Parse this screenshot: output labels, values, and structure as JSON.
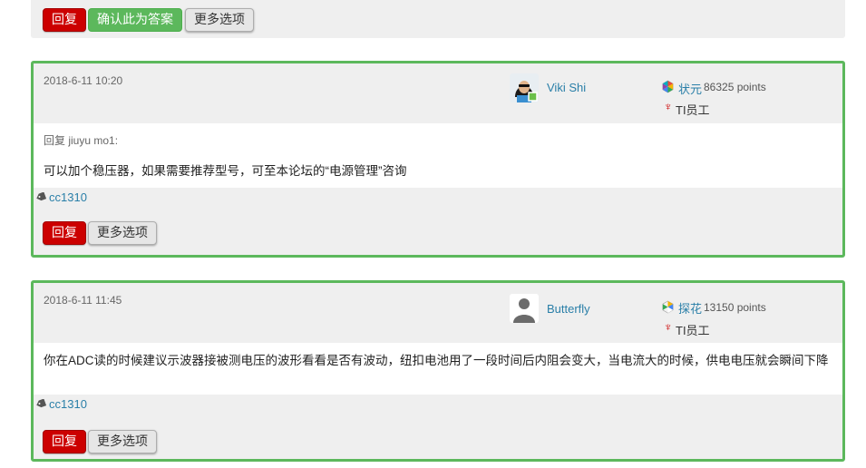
{
  "top_actions": {
    "reply_label": "回复",
    "confirm_label": "确认此为答案",
    "more_label": "更多选项"
  },
  "posts": [
    {
      "date": "2018-6-11 10:20",
      "author": "Viki Shi",
      "rank": "状元",
      "points": "86325 points",
      "badge": "TI员工",
      "reply_to": "回复 jiuyu mo1:",
      "content": "可以加个稳压器，如果需要推荐型号，可至本论坛的“电源管理”咨询",
      "tag": "cc1310",
      "reply_label": "回复",
      "more_label": "更多选项"
    },
    {
      "date": "2018-6-11 11:45",
      "author": "Butterfly",
      "rank": "探花",
      "points": "13150 points",
      "badge": "TI员工",
      "content": "你在ADC读的时候建议示波器接被测电压的波形看看是否有波动，纽扣电池用了一段时间后内阻会变大，当电流大的时候，供电电压就会瞬间下降",
      "tag": "cc1310",
      "reply_label": "回复",
      "more_label": "更多选项"
    }
  ],
  "colors": {
    "accent_green": "#5cb85c",
    "reply_red": "#cc0000",
    "link_blue": "#2a7fa8"
  },
  "icons": {
    "rank": "rank-badge-icon",
    "ti": "ti-logo-icon",
    "tag": "tag-icon"
  }
}
